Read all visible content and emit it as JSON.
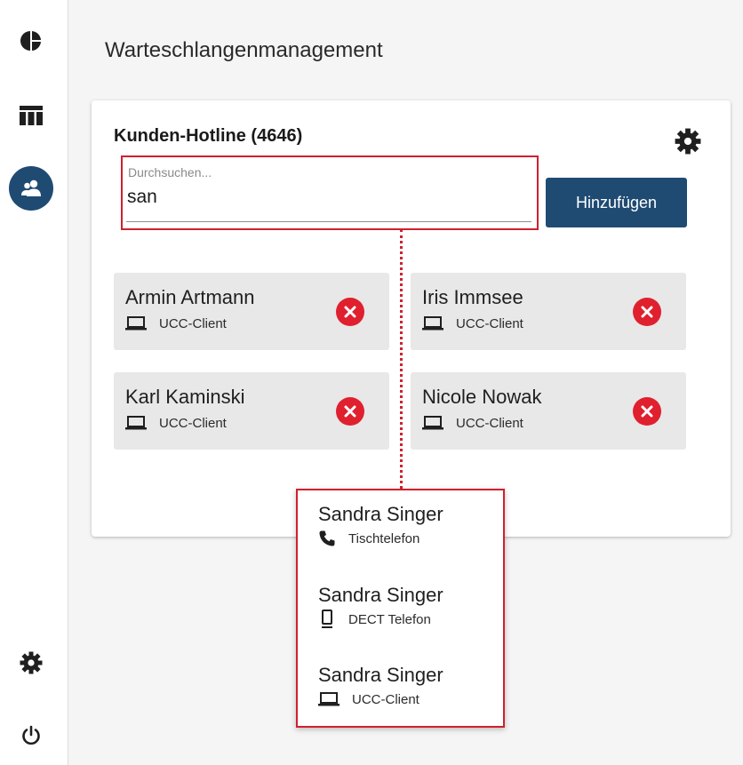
{
  "page": {
    "title": "Warteschlangenmanagement"
  },
  "colors": {
    "accent": "#1f4b73",
    "danger": "#e0202e",
    "highlight": "#d0202e"
  },
  "sidebar": {
    "top_items": [
      {
        "icon": "pie-chart-icon"
      },
      {
        "icon": "table-icon"
      },
      {
        "icon": "users-icon",
        "active": true
      }
    ],
    "bottom_items": [
      {
        "icon": "gear-icon"
      },
      {
        "icon": "power-icon"
      }
    ]
  },
  "queue": {
    "title": "Kunden-Hotline (4646)",
    "search": {
      "label": "Durchsuchen...",
      "value": "san"
    },
    "add_label": "Hinzufügen",
    "members": [
      {
        "name": "Armin Artmann",
        "device": "UCC-Client",
        "device_icon": "laptop-icon"
      },
      {
        "name": "Iris Immsee",
        "device": "UCC-Client",
        "device_icon": "laptop-icon"
      },
      {
        "name": "Karl Kaminski",
        "device": "UCC-Client",
        "device_icon": "laptop-icon"
      },
      {
        "name": "Nicole Nowak",
        "device": "UCC-Client",
        "device_icon": "laptop-icon"
      }
    ]
  },
  "suggestions": [
    {
      "name": "Sandra Singer",
      "device": "Tischtelefon",
      "device_icon": "phone-icon"
    },
    {
      "name": "Sandra Singer",
      "device": "DECT Telefon",
      "device_icon": "mobile-phone-icon"
    },
    {
      "name": "Sandra Singer",
      "device": "UCC-Client",
      "device_icon": "laptop-icon"
    }
  ]
}
